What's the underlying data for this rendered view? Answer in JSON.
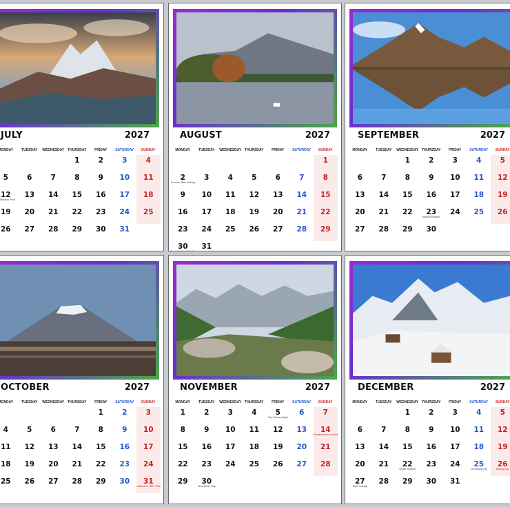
{
  "weekdays": [
    "MONDAY",
    "TUESDAY",
    "WEDNESDAY",
    "THURSDAY",
    "FRIDAY",
    "SATURDAY",
    "SUNDAY"
  ],
  "months": [
    {
      "name": "JULY",
      "year": "2027",
      "days": [
        "",
        "",
        "",
        "1",
        "2",
        "3",
        "4",
        "5",
        "6",
        "7",
        "8",
        "9",
        "10",
        "11",
        "12",
        "13",
        "14",
        "15",
        "16",
        "17",
        "18",
        "19",
        "20",
        "21",
        "22",
        "23",
        "24",
        "25",
        "26",
        "27",
        "28",
        "29",
        "30",
        "31",
        ""
      ],
      "notes": {
        "12": "Wimbledon Final"
      }
    },
    {
      "name": "AUGUST",
      "year": "2027",
      "days": [
        "",
        "",
        "",
        "",
        "",
        "",
        "1",
        "2",
        "3",
        "4",
        "5",
        "6",
        "7",
        "8",
        "9",
        "10",
        "11",
        "12",
        "13",
        "14",
        "15",
        "16",
        "17",
        "18",
        "19",
        "20",
        "21",
        "22",
        "23",
        "24",
        "25",
        "26",
        "27",
        "28",
        "29",
        "30",
        "31",
        "",
        "",
        "",
        "",
        ""
      ],
      "notes": {
        "2": "Summer Bank Holiday",
        "30": "Bank Holiday (Not Sco)"
      }
    },
    {
      "name": "SEPTEMBER",
      "year": "2027",
      "days": [
        "",
        "",
        "1",
        "2",
        "3",
        "4",
        "5",
        "6",
        "7",
        "8",
        "9",
        "10",
        "11",
        "12",
        "13",
        "14",
        "15",
        "16",
        "17",
        "18",
        "19",
        "20",
        "21",
        "22",
        "23",
        "24",
        "25",
        "26",
        "27",
        "28",
        "29",
        "30",
        "",
        "",
        ""
      ],
      "notes": {
        "23": "Autumn Equinox"
      }
    },
    {
      "name": "OCTOBER",
      "year": "2027",
      "days": [
        "",
        "",
        "",
        "",
        "1",
        "2",
        "3",
        "4",
        "5",
        "6",
        "7",
        "8",
        "9",
        "10",
        "11",
        "12",
        "13",
        "14",
        "15",
        "16",
        "17",
        "18",
        "19",
        "20",
        "21",
        "22",
        "23",
        "24",
        "25",
        "26",
        "27",
        "28",
        "29",
        "30",
        "31"
      ],
      "notes": {
        "31": "Halloween / BST Ends"
      }
    },
    {
      "name": "NOVEMBER",
      "year": "2027",
      "days": [
        "1",
        "2",
        "3",
        "4",
        "5",
        "6",
        "7",
        "8",
        "9",
        "10",
        "11",
        "12",
        "13",
        "14",
        "15",
        "16",
        "17",
        "18",
        "19",
        "20",
        "21",
        "22",
        "23",
        "24",
        "25",
        "26",
        "27",
        "28",
        "29",
        "30",
        "",
        "",
        "",
        "",
        ""
      ],
      "notes": {
        "5": "Guy Fawkes Night",
        "14": "Remembrance Sunday",
        "30": "St Andrew's Day"
      }
    },
    {
      "name": "DECEMBER",
      "year": "2027",
      "days": [
        "",
        "",
        "1",
        "2",
        "3",
        "4",
        "5",
        "6",
        "7",
        "8",
        "9",
        "10",
        "11",
        "12",
        "13",
        "14",
        "15",
        "16",
        "17",
        "18",
        "19",
        "20",
        "21",
        "22",
        "23",
        "24",
        "25",
        "26",
        "27",
        "28",
        "29",
        "30",
        "31",
        "",
        ""
      ],
      "notes": {
        "22": "Winter Solstice",
        "25": "Christmas Day",
        "26": "Boxing Day",
        "27": "Bank Holiday"
      }
    }
  ]
}
